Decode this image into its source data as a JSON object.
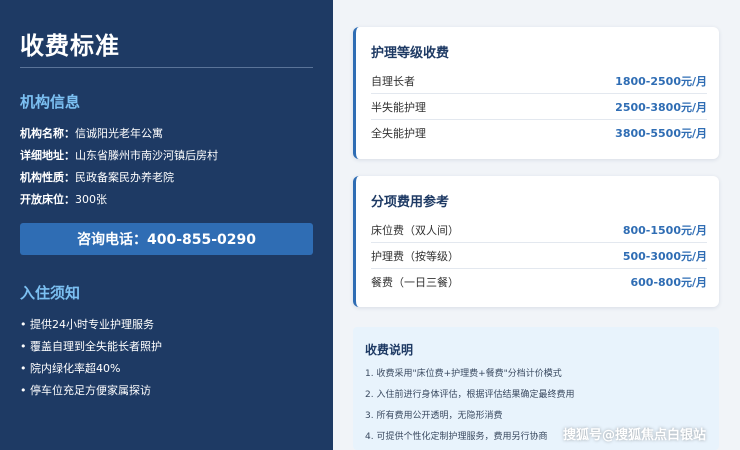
{
  "left": {
    "title": "收费标准",
    "org_section": "机构信息",
    "info": [
      {
        "k": "机构名称：",
        "v": "信诚阳光老年公寓"
      },
      {
        "k": "详细地址：",
        "v": "山东省滕州市南沙河镇后房村"
      },
      {
        "k": "机构性质：",
        "v": "民政备案民办养老院"
      },
      {
        "k": "开放床位：",
        "v": "300张"
      }
    ],
    "call_button": "咨询电话：400-855-0290",
    "notice_section": "入住须知",
    "notices": [
      "• 提供24小时专业护理服务",
      "• 覆盖自理到全失能长者照护",
      "• 院内绿化率超40%",
      "• 停车位充足方便家属探访"
    ]
  },
  "care_card": {
    "title": "护理等级收费",
    "rows": [
      {
        "label": "自理长者",
        "price": "1800-2500元/月"
      },
      {
        "label": "半失能护理",
        "price": "2500-3800元/月"
      },
      {
        "label": "全失能护理",
        "price": "3800-5500元/月"
      }
    ]
  },
  "fee_card": {
    "title": "分项费用参考",
    "rows": [
      {
        "label": "床位费（双人间）",
        "price": "800-1500元/月"
      },
      {
        "label": "护理费（按等级）",
        "price": "500-3000元/月"
      },
      {
        "label": "餐费（一日三餐）",
        "price": "600-800元/月"
      }
    ]
  },
  "notes": {
    "title": "收费说明",
    "lines": [
      "1. 收费采用\"床位费+护理费+餐费\"分档计价模式",
      "2. 入住前进行身体评估，根据评估结果确定最终费用",
      "3. 所有费用公开透明，无隐形消费",
      "4. 可提供个性化定制护理服务，费用另行协商"
    ]
  },
  "watermark": "搜狐号@搜狐焦点白银站",
  "colors": {
    "left_bg": "#1e3a64",
    "accent": "#2f6db4",
    "heading_blue": "#7cc0f2",
    "notes_bg": "#e8f3fc"
  }
}
